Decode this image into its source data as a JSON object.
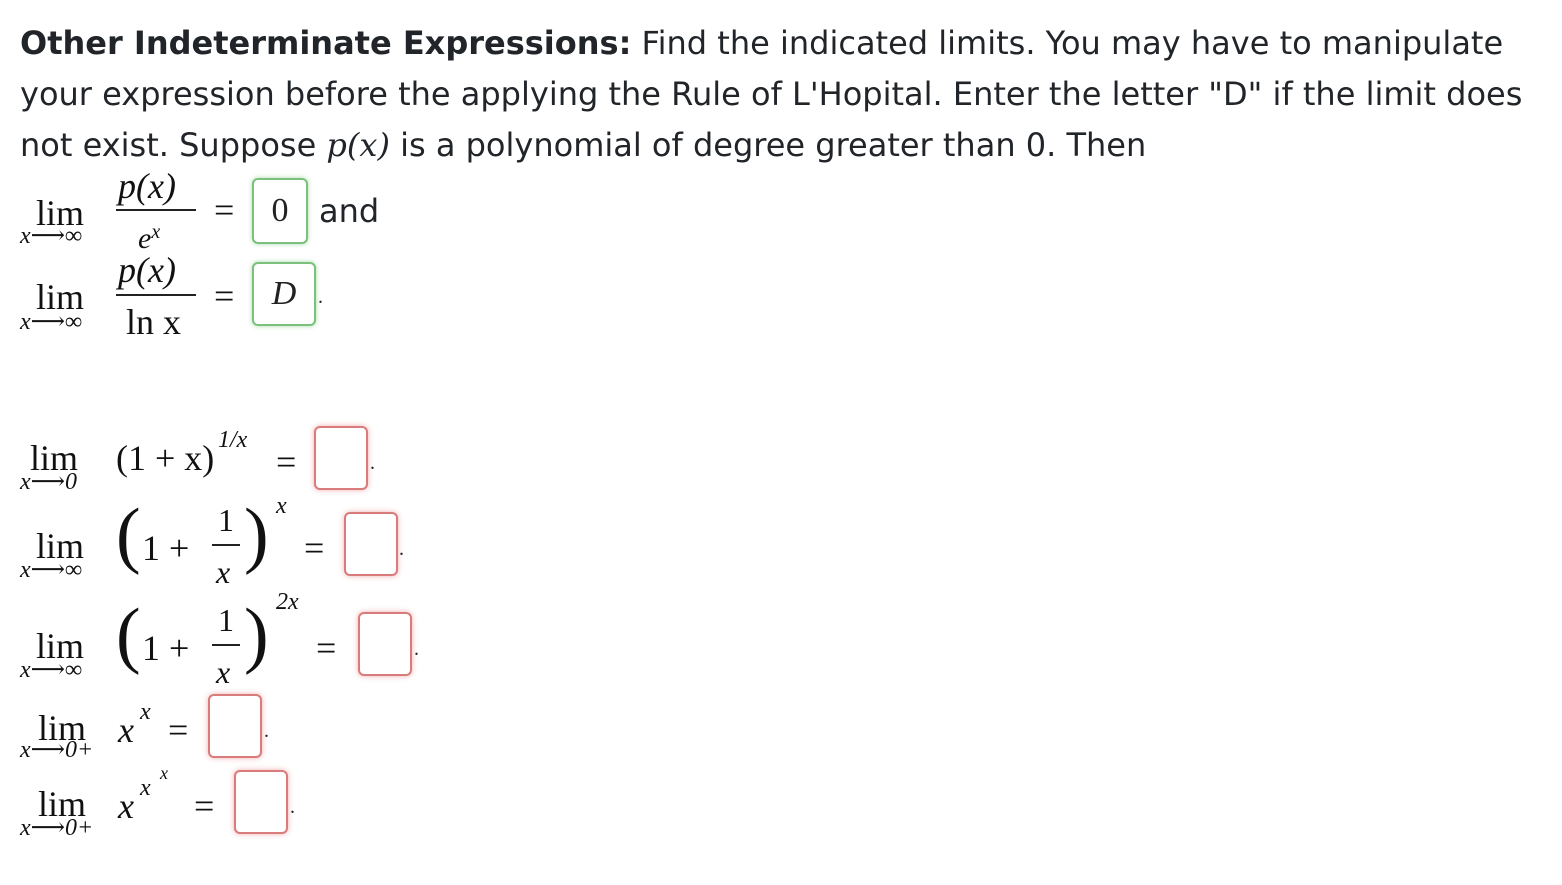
{
  "intro": {
    "heading": "Other Indeterminate Expressions:",
    "text": " Find the indicated limits. You may have to manipulate your expression before the applying the Rule of L'Hopital. Enter the letter \"D\" if the limit does not exist. Suppose ",
    "p_of_x": "p(x)",
    "text2": " is a polynomial of degree greater than 0. Then"
  },
  "limits": [
    {
      "lim": "lim",
      "sub": "x⟶∞",
      "numerator": "p(x)",
      "denominator": "e",
      "den_sup": "x",
      "answer": "0",
      "status": "correct",
      "after": "and"
    },
    {
      "lim": "lim",
      "sub": "x⟶∞",
      "numerator": "p(x)",
      "denominator": "ln x",
      "answer": "D",
      "status": "correct",
      "after": "."
    },
    {
      "lim": "lim",
      "sub": "x⟶0",
      "expr": "(1 + x)",
      "exp": "1/x",
      "answer": "",
      "status": "incorrect",
      "after": "."
    },
    {
      "lim": "lim",
      "sub": "x⟶∞",
      "base_left": "1 +",
      "frac_num": "1",
      "frac_den": "x",
      "exp": "x",
      "answer": "",
      "status": "incorrect",
      "after": "."
    },
    {
      "lim": "lim",
      "sub": "x⟶∞",
      "base_left": "1 +",
      "frac_num": "1",
      "frac_den": "x",
      "exp": "2x",
      "answer": "",
      "status": "incorrect",
      "after": "."
    },
    {
      "lim": "lim",
      "sub": "x⟶0+",
      "expr": "x",
      "exp": "x",
      "answer": "",
      "status": "incorrect",
      "after": "."
    },
    {
      "lim": "lim",
      "sub": "x⟶0+",
      "expr": "x",
      "exp": "x",
      "exp2": "x",
      "answer": "",
      "status": "incorrect",
      "after": "."
    }
  ],
  "colors": {
    "correct_border": "#7cc07d",
    "incorrect_border": "#d97b7b",
    "text": "#212529"
  }
}
